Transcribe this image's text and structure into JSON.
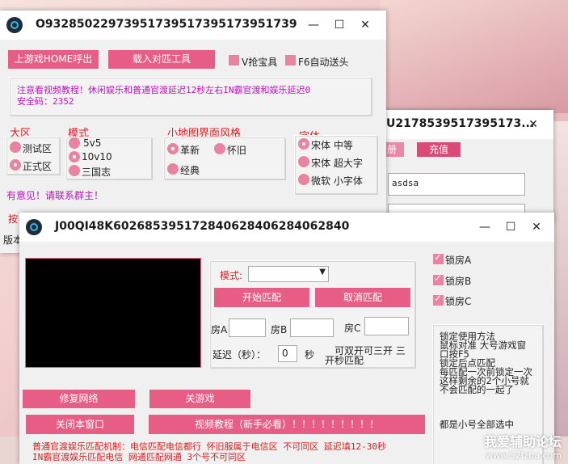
{
  "win1": {
    "title": "O93285022973951739517395173951739",
    "btn_home": "上游戏HOME呼出",
    "btn_load": "载入对匹工具",
    "chk_v": "V抢宝具",
    "chk_f6": "F6自动送头",
    "notice_line1": "注意看视频教程！休闲娱乐和普通官渡延迟12秒左右IN霸官渡和娱乐延迟0",
    "notice_line2": "安全码：2352",
    "region_title": "大区",
    "region_test": "测试区",
    "region_official": "正式区",
    "mode_title": "模式",
    "mode_5v5": "5v5",
    "mode_10v10": "10v10",
    "mode_3k": "三国志",
    "map_title": "小地图界面风格",
    "map_new": "革新",
    "map_old": "怀旧",
    "map_classic": "经典",
    "font_title": "字体",
    "font_song_mid": "宋体 中等",
    "font_song_big": "宋体 超大字",
    "font_ms_small": "微软 小字体",
    "feedback": "有意见！请联系群主！",
    "partial1": "按",
    "partial2": "版本"
  },
  "win2": {
    "title": "U2178539517395173...",
    "tab_reg": "册",
    "tab_recharge": "充值",
    "input_value": "asdsa"
  },
  "win3": {
    "title": "J00QI48K602685395172840628406284062840",
    "mode_label": "模式:",
    "btn_start": "开始匹配",
    "btn_cancel": "取消匹配",
    "roomA": "房A",
    "roomB": "房B",
    "roomC": "房C",
    "delay_label": "延迟（秒）：",
    "delay_value": "0",
    "sec": "秒",
    "note_line1": "可双开可三开  三",
    "note_line2": "开秒匹配",
    "lockA": "锁房A",
    "lockB": "锁房B",
    "lockC": "锁房C",
    "help_lines": [
      "锁定使用方法",
      "鼠标对准 大号游戏窗",
      "口按F5",
      "锁定后点匹配",
      "每匹配一次前锁定一次",
      "这样剩余的2个小号就",
      "不会匹配的一起了"
    ],
    "help_footer": "都是小号全部选中",
    "btn_repair": "修复网络",
    "btn_close_game": "关游戏",
    "btn_close_win": "关闭本窗口",
    "btn_video": "视频教程（新手必看）！！！！！！！！！",
    "mech_line1": "普通官渡娱乐匹配机制：电信匹配电信都行 怀旧服属于电信区 不可同区 延迟填12-30秒",
    "mech_line2": "IN霸官渡娱乐匹配电信 网通匹配网通 3个号不可同区"
  },
  "watermark": {
    "line1": "我爱辅助论坛",
    "line2": "www.52fzba.com"
  },
  "colors": {
    "accent": "#e85d86",
    "red_text": "#d81f1f",
    "magenta_text": "#c010c0"
  }
}
